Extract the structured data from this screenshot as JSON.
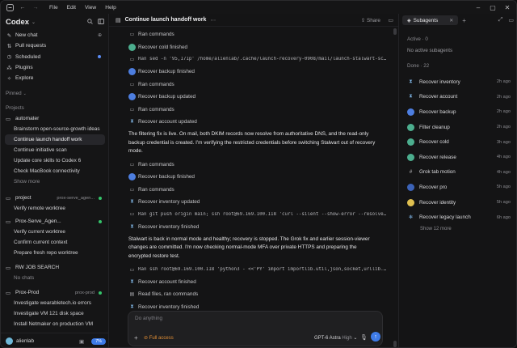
{
  "titlebar": {
    "menu": [
      "File",
      "Edit",
      "View",
      "Help"
    ],
    "icons": [
      "app-icon",
      "back-icon",
      "forward-icon"
    ]
  },
  "sidebar": {
    "app_name": "Codex",
    "nav": [
      {
        "label": "New chat",
        "icon": "new-chat-icon"
      },
      {
        "label": "Pull requests",
        "icon": "pull-request-icon"
      },
      {
        "label": "Scheduled",
        "icon": "clock-icon"
      },
      {
        "label": "Plugins",
        "icon": "plugin-icon"
      },
      {
        "label": "Explore",
        "icon": "compass-icon"
      }
    ],
    "pinned_label": "Pinned",
    "projects_label": "Projects",
    "projects": [
      {
        "name": "automater",
        "tag": "",
        "threads": [
          "Brainstorm open-source-growth ideas",
          "Continue launch handoff work",
          "Continue initiative scan",
          "Update core skills to Codex 6",
          "Check MacBook connectivity",
          "Show more"
        ]
      },
      {
        "name": "project",
        "tag": "prox-serve_agen...",
        "threads": [
          "Verify remote worktree"
        ]
      },
      {
        "name": "Prox-Serve_Agen...",
        "tag": "",
        "threads": [
          "Verify current worktree",
          "Confirm current context",
          "Prepare fresh repo worktree"
        ]
      },
      {
        "name": "RW JOB SEARCH",
        "tag": "",
        "threads": [
          "No chats"
        ]
      },
      {
        "name": "Prox-Prod",
        "tag": "prox-prod",
        "threads": [
          "Investigate wearabletech.io errors",
          "Investigate VM 121 disk space",
          "Install Netmaker on production VM"
        ]
      }
    ],
    "user": "alienlab",
    "usage": "7%"
  },
  "main": {
    "title": "Continue launch handoff work",
    "share_label": "Share",
    "events": [
      {
        "type": "event",
        "icon": "terminal-icon",
        "text": "Ran commands"
      },
      {
        "type": "event",
        "icon": "agent-green-icon",
        "text": "Recover cold finished"
      },
      {
        "type": "event",
        "icon": "terminal-icon",
        "code": true,
        "text": "Ran sed -n '95,171p' /home/alienlab/.cache/launch-recovery-0908/mail/launch-stalwart-scoped-api-keys-0909...."
      },
      {
        "type": "event",
        "icon": "agent-blue-icon",
        "text": "Recover backup finished"
      },
      {
        "type": "event",
        "icon": "terminal-icon",
        "text": "Ran commands"
      },
      {
        "type": "event",
        "icon": "agent-blue-icon",
        "text": "Recover backup updated"
      },
      {
        "type": "event",
        "icon": "terminal-icon",
        "text": "Ran commands"
      },
      {
        "type": "event",
        "icon": "hourglass-icon",
        "text": "Recover account updated"
      },
      {
        "type": "para",
        "text": "The filtering fix is live. On mail, both DKIM records now resolve from authoritative DNS, and the read-only backup credential is created. I'm verifying the restricted credentials before switching Stalwart out of recovery mode."
      },
      {
        "type": "event",
        "icon": "terminal-icon",
        "text": "Ran commands"
      },
      {
        "type": "event",
        "icon": "agent-blue-icon",
        "text": "Recover backup finished"
      },
      {
        "type": "event",
        "icon": "terminal-icon",
        "text": "Ran commands"
      },
      {
        "type": "event",
        "icon": "hourglass-icon",
        "text": "Recover inventory updated"
      },
      {
        "type": "event",
        "icon": "terminal-icon",
        "code": true,
        "text": "Ran git push origin main; ssh root@69.169.100.118 'curl --silent --show-error --resolve mail-admin.automater.a..."
      },
      {
        "type": "event",
        "icon": "hourglass-icon",
        "text": "Recover inventory finished"
      },
      {
        "type": "para",
        "text": "Stalwart is back in normal mode and healthy; recovery is stopped. The Grok fix and earlier session-viewer changes are committed. I'm now checking normal-mode MFA over private HTTPS and preparing the encrypted restore test."
      },
      {
        "type": "event",
        "icon": "terminal-icon",
        "code": true,
        "text": "Ran ssh root@69.169.100.118 'python3 - <<'PY' import importlib.util,json,socket,urllib.request,urllib.error,base..."
      },
      {
        "type": "event",
        "icon": "hourglass-icon",
        "text": "Recover account finished"
      },
      {
        "type": "event",
        "icon": "file-icon",
        "text": "Read files, ran commands"
      },
      {
        "type": "event",
        "icon": "hourglass-icon",
        "text": "Recover inventory finished"
      }
    ],
    "composer": {
      "placeholder": "Do anything",
      "access": "Full access",
      "model": "GPT-6 Astra",
      "level": "High"
    }
  },
  "rpanel": {
    "tab": "Subagents",
    "active_label": "Active · 0",
    "no_active": "No active subagents",
    "done_label": "Done · 22",
    "agents": [
      {
        "name": "Recover inventory",
        "time": "2h ago",
        "icon": "hourglass-icon"
      },
      {
        "name": "Recover account",
        "time": "2h ago",
        "icon": "hourglass-icon"
      },
      {
        "name": "Recover backup",
        "time": "2h ago",
        "icon": "agent-blue-icon"
      },
      {
        "name": "Filter cleanup",
        "time": "2h ago",
        "icon": "agent-green-icon"
      },
      {
        "name": "Recover cold",
        "time": "3h ago",
        "icon": "agent-green-icon"
      },
      {
        "name": "Recover release",
        "time": "4h ago",
        "icon": "agent-green-icon"
      },
      {
        "name": "Grok tab motion",
        "time": "4h ago",
        "icon": "grid-icon"
      },
      {
        "name": "Recover pro",
        "time": "5h ago",
        "icon": "agent-navy-icon"
      },
      {
        "name": "Recover identity",
        "time": "5h ago",
        "icon": "agent-yellow-icon"
      },
      {
        "name": "Recover legacy launch",
        "time": "6h ago",
        "icon": "gear-icon"
      }
    ],
    "show_more": "Show 12 more"
  },
  "colors": {
    "accent": "#3e7be8",
    "green_dot": "#35c46a",
    "warning": "#e08e35"
  }
}
